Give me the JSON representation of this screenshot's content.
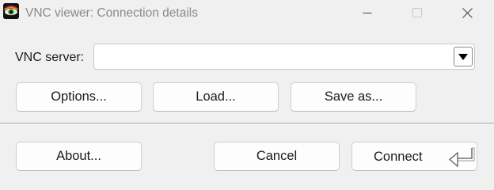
{
  "window": {
    "title": "VNC viewer: Connection details",
    "icon": "vnc-eye-icon",
    "controls": [
      "minimize-icon",
      "maximize-icon",
      "close-icon"
    ]
  },
  "form": {
    "server_label": "VNC server:",
    "server_value": "",
    "server_placeholder": "",
    "dropdown_icon": "chevron-down-icon"
  },
  "buttons_top": {
    "options": "Options...",
    "load": "Load...",
    "save_as": "Save as..."
  },
  "buttons_bottom": {
    "about": "About...",
    "cancel": "Cancel",
    "connect": "Connect",
    "connect_icon": "enter-key-icon"
  },
  "colors": {
    "background": "#f0f0f0",
    "title_text": "#8a8a8a",
    "button_face": "#fdfdfd",
    "button_border": "#cfcfcf"
  }
}
